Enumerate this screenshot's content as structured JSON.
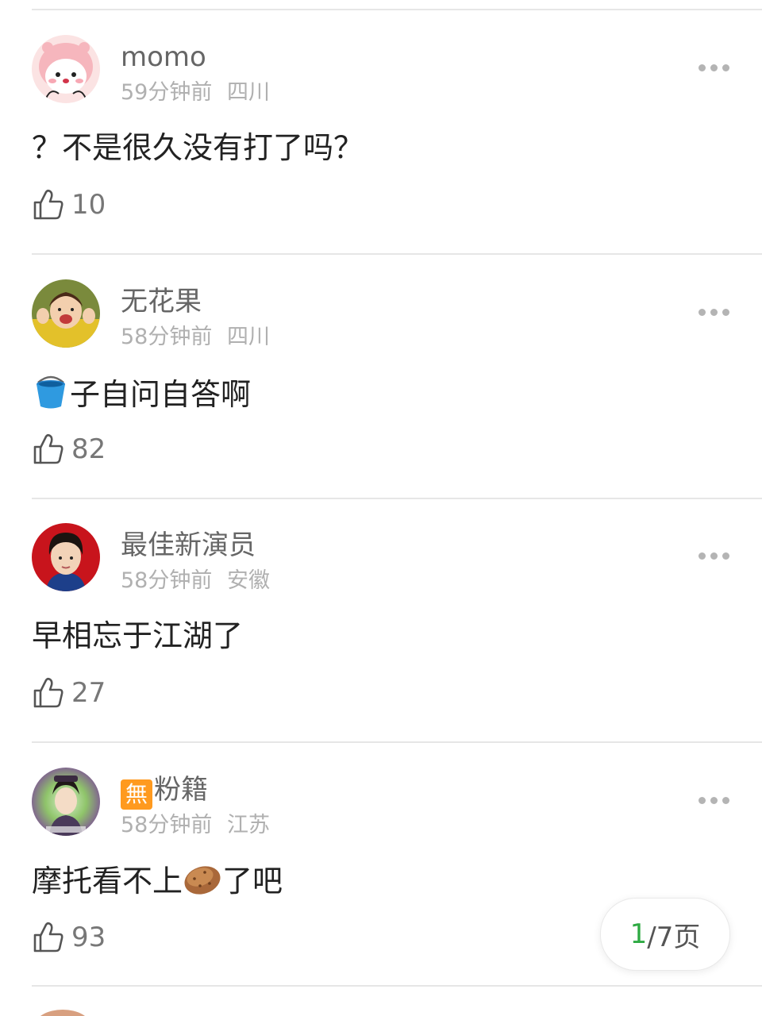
{
  "comments": [
    {
      "username": "momo",
      "time": "59分钟前",
      "location": "四川",
      "text": "？不是很久没有打了吗？",
      "likes": "10",
      "avatar_icon": "pink-cartoon-avatar"
    },
    {
      "username": "无花果",
      "time": "58分钟前",
      "location": "四川",
      "text_emoji": "bucket-emoji",
      "text": "子自问自答啊",
      "likes": "82",
      "avatar_icon": "child-photo-avatar"
    },
    {
      "username": "最佳新演员",
      "time": "58分钟前",
      "location": "安徽",
      "text": "早相忘于江湖了",
      "likes": "27",
      "avatar_icon": "boy-portrait-avatar"
    },
    {
      "badge": "無",
      "username": "粉籍",
      "time": "58分钟前",
      "location": "江苏",
      "text_before": "摩托看不上",
      "text_emoji": "potato-emoji",
      "text_after": "了吧",
      "likes": "93",
      "avatar_icon": "costume-portrait-avatar"
    }
  ],
  "pager": {
    "current": "1",
    "total_text": "/7页"
  },
  "colors": {
    "accent_green": "#2eaa43",
    "badge_orange": "#ff9a1f",
    "meta_gray": "#b0b0b0"
  }
}
